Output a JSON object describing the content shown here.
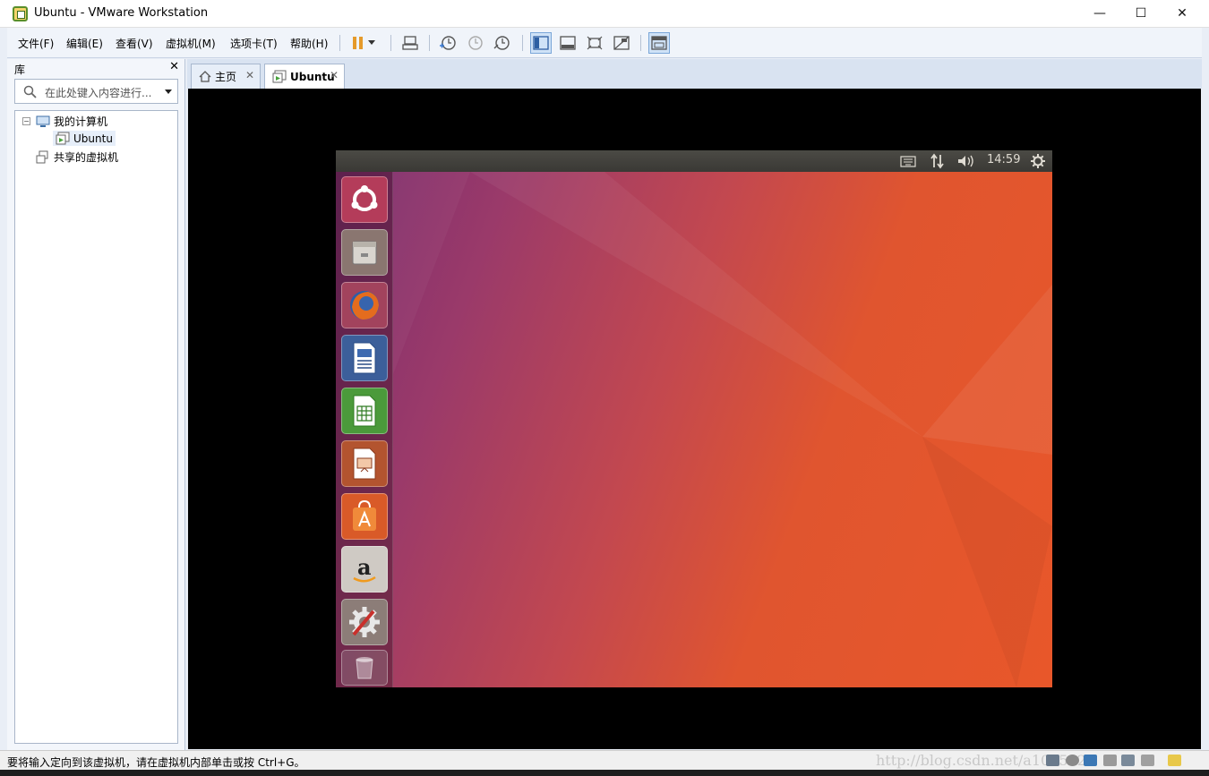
{
  "window": {
    "title": "Ubuntu - VMware Workstation"
  },
  "window_controls": {
    "minimize": "—",
    "maximize": "☐",
    "close": "✕"
  },
  "menu": [
    "文件(F)",
    "编辑(E)",
    "查看(V)",
    "虚拟机(M)",
    "选项卡(T)",
    "帮助(H)"
  ],
  "library": {
    "title": "库",
    "close": "✕",
    "search_placeholder": "在此处键入内容进行...",
    "tree": {
      "my_computer": "我的计算机",
      "vm": "Ubuntu",
      "shared": "共享的虚拟机"
    }
  },
  "tabs": [
    {
      "label": "主页",
      "active": false
    },
    {
      "label": "Ubuntu",
      "active": true
    }
  ],
  "guest": {
    "clock": "14:59",
    "launcher": [
      "ubuntu-dash-icon",
      "files-icon",
      "firefox-icon",
      "writer-icon",
      "calc-icon",
      "impress-icon",
      "software-center-icon",
      "amazon-icon",
      "system-settings-icon",
      "trash-icon"
    ]
  },
  "status": {
    "message": "要将输入定向到该虚拟机，请在虚拟机内部单击或按 Ctrl+G。",
    "watermark": "http://blog.csdn.net/a1025921"
  },
  "colors": {
    "accent": "#5a8f2a",
    "wallpaper_left": "#7a2b6e",
    "wallpaper_right": "#e8572a"
  }
}
